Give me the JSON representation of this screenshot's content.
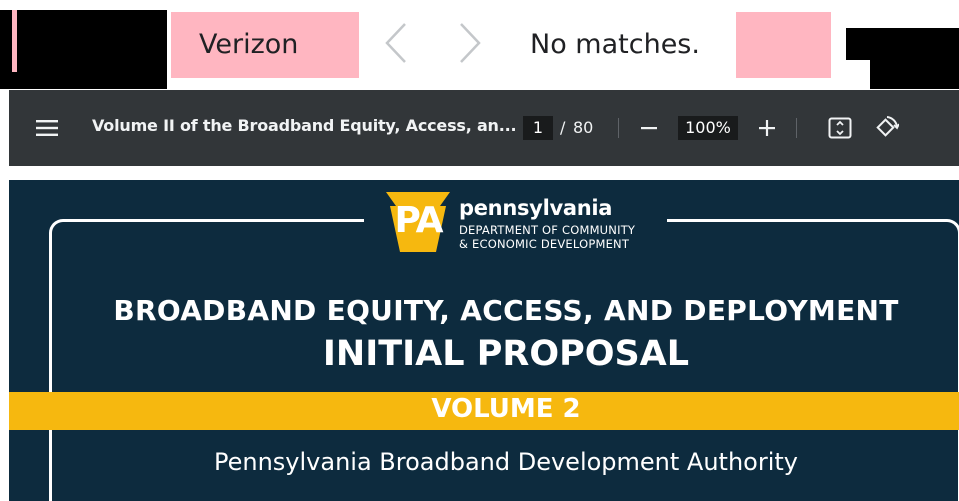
{
  "find_bar": {
    "query": "Verizon",
    "status": "No matches.",
    "prev_icon": "chevron-left-icon",
    "next_icon": "chevron-right-icon"
  },
  "toolbar": {
    "menu_icon": "hamburger-menu-icon",
    "title": "Volume II of the Broadband Equity, Access, an...",
    "current_page": "1",
    "page_separator": "/",
    "total_pages": "80",
    "zoom": "100%",
    "zoom_out_icon": "minus-icon",
    "zoom_in_icon": "plus-icon",
    "fit_icon": "fit-to-page-icon",
    "rotate_icon": "rotate-icon"
  },
  "document": {
    "logo_mark": "PA",
    "brand": "pennsylvania",
    "department_line1": "DEPARTMENT OF COMMUNITY",
    "department_line2": "& ECONOMIC DEVELOPMENT",
    "headline": "BROADBAND EQUITY, ACCESS, AND DEPLOYMENT",
    "subheadline": "INITIAL PROPOSAL",
    "volume": "VOLUME 2",
    "authority": "Pennsylvania Broadband Development Authority"
  },
  "colors": {
    "highlight_pink": "#ffb6c1",
    "toolbar_bg": "#323639",
    "doc_navy": "#0d2b3e",
    "accent_gold": "#f6b80f"
  }
}
